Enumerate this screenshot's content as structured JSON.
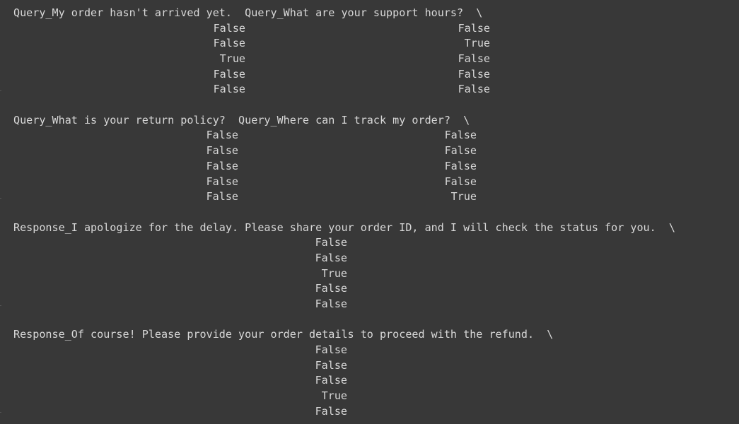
{
  "output": {
    "block1": {
      "header": "Query_My order hasn't arrived yet.  Query_What are your support hours?  \\",
      "col1": [
        "False",
        "False",
        "True",
        "False",
        "False"
      ],
      "col2": [
        "False",
        "True",
        "False",
        "False",
        "False"
      ]
    },
    "block2": {
      "header": "Query_What is your return policy?  Query_Where can I track my order?  \\",
      "col1": [
        "False",
        "False",
        "False",
        "False",
        "False"
      ],
      "col2": [
        "False",
        "False",
        "False",
        "False",
        "True"
      ]
    },
    "block3": {
      "header": "Response_I apologize for the delay. Please share your order ID, and I will check the status for you.  \\",
      "col1": [
        "False",
        "False",
        "True",
        "False",
        "False"
      ]
    },
    "block4": {
      "header": "Response_Of course! Please provide your order details to proceed with the refund.  \\",
      "col1": [
        "False",
        "False",
        "False",
        "True",
        "False"
      ]
    }
  }
}
